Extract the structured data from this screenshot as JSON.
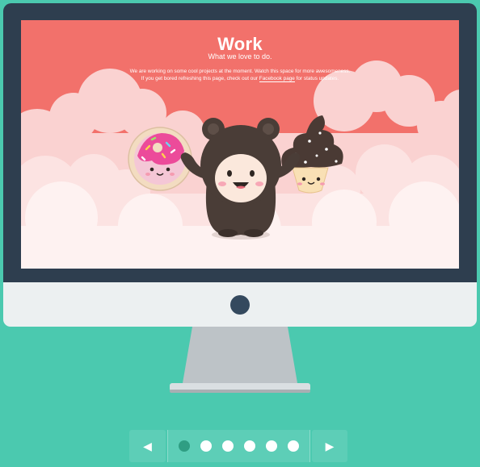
{
  "screen": {
    "title": "Work",
    "subtitle": "What we love to do.",
    "body_line1": "We are working on some cool projects at the moment. Watch this space for more awesomeness.",
    "body_line2_prefix": "If you get bored refreshing this page, check out our ",
    "body_link": "Facebook page",
    "body_line2_suffix": " for status updates."
  },
  "illustration": {
    "characters": [
      "donut-icon",
      "bear-mascot-icon",
      "cupcake-icon"
    ]
  },
  "pager": {
    "prev_icon": "◀",
    "next_icon": "▶",
    "total_slides": 6,
    "active_index": 0
  },
  "colors": {
    "background": "#4bc9af",
    "bezel": "#2e3e4f",
    "chin": "#ecf0f1",
    "screen": "#f2716b",
    "active_dot": "#2f9e83"
  }
}
